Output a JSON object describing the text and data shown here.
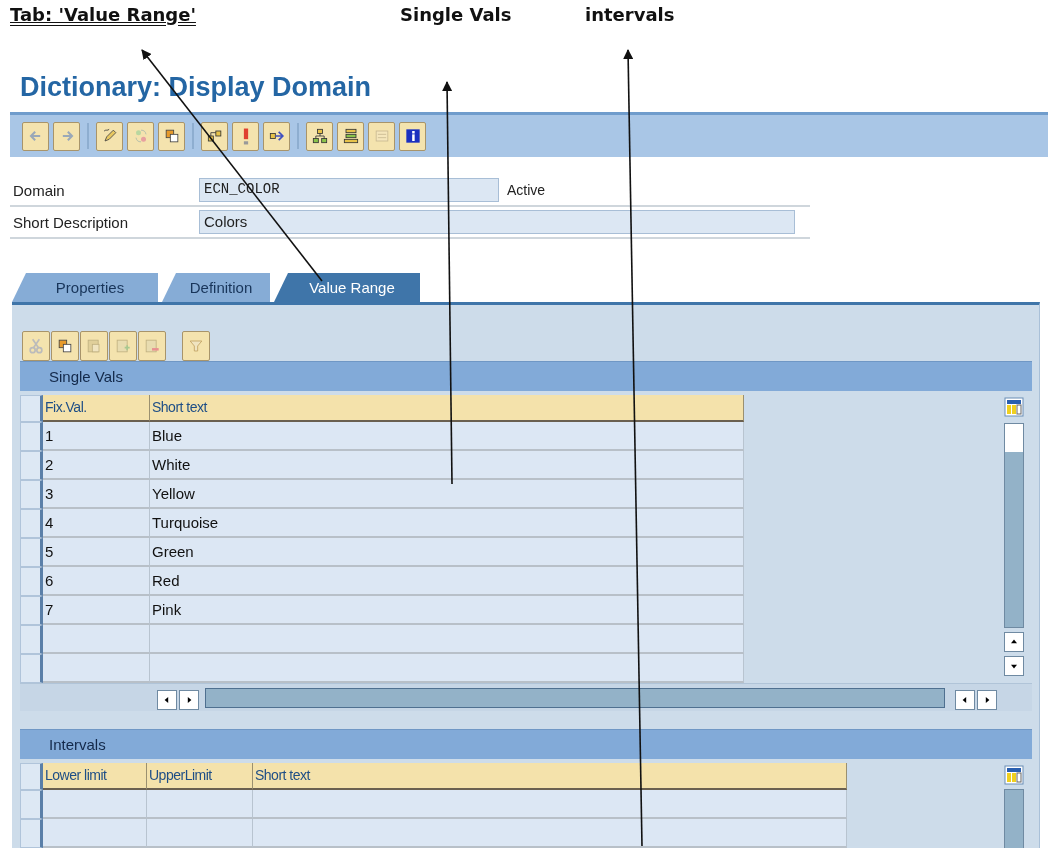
{
  "annotations": [
    {
      "text": "Tab: 'Value Range'",
      "underlined": true
    },
    {
      "text": "Single Vals",
      "underlined": false
    },
    {
      "text": "intervals",
      "underlined": false
    }
  ],
  "title": "Dictionary: Display Domain",
  "fields": [
    {
      "label": "Domain",
      "value": "ECN_COLOR",
      "status": "Active"
    },
    {
      "label": "Short Description",
      "value": "Colors"
    }
  ],
  "tabs": [
    {
      "label": "Properties",
      "selected": false
    },
    {
      "label": "Definition",
      "selected": false
    },
    {
      "label": "Value Range",
      "selected": true
    }
  ],
  "single_values": {
    "title": "Single Vals",
    "columns": [
      "Fix.Val.",
      "Short text"
    ],
    "rows": [
      [
        "1",
        "Blue"
      ],
      [
        "2",
        "White"
      ],
      [
        "3",
        "Yellow"
      ],
      [
        "4",
        "Turquoise"
      ],
      [
        "5",
        "Green"
      ],
      [
        "6",
        "Red"
      ],
      [
        "7",
        "Pink"
      ]
    ]
  },
  "intervals": {
    "title": "Intervals",
    "columns": [
      "Lower limit",
      "UpperLimit",
      "Short text"
    ]
  }
}
